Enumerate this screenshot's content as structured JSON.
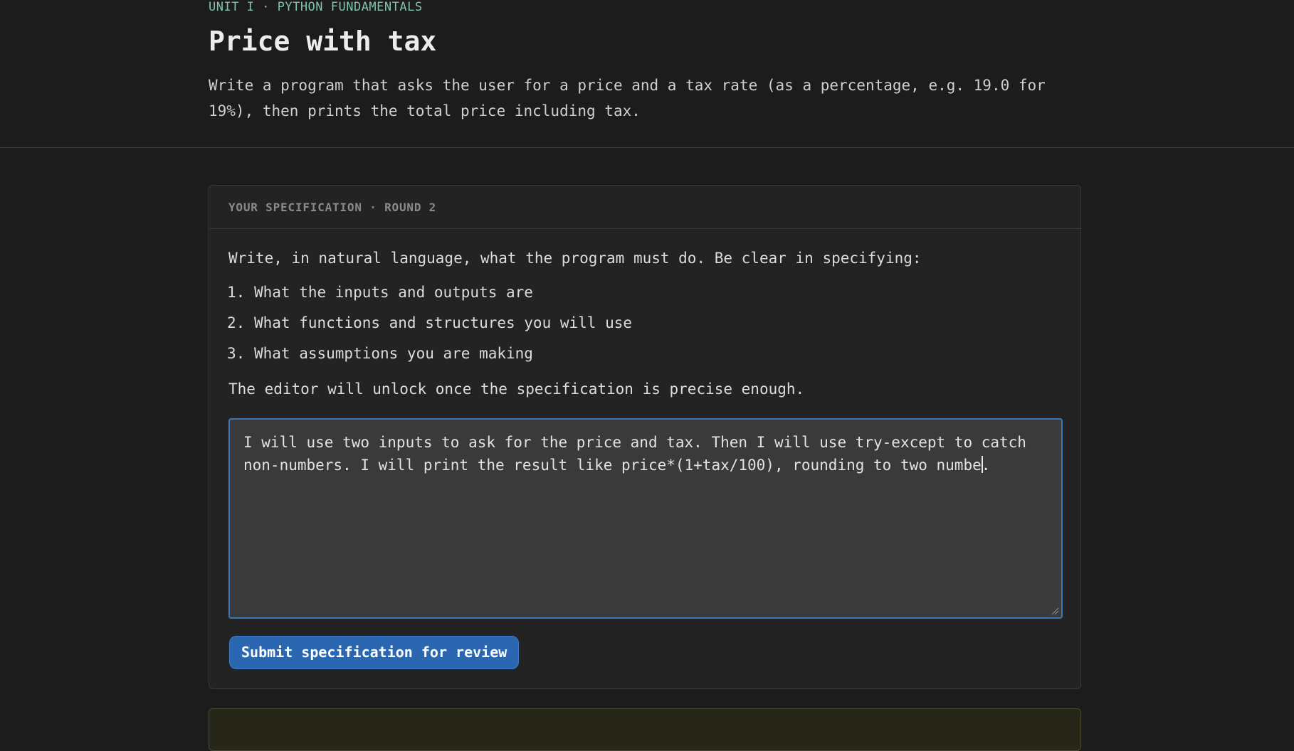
{
  "header": {
    "eyebrow": "UNIT I · PYTHON FUNDAMENTALS",
    "title": "Price with tax",
    "description": "Write a program that asks the user for a price and a tax rate (as a percentage, e.g. 19.0 for 19%), then prints the total price including tax."
  },
  "spec_card": {
    "header_label": "YOUR SPECIFICATION · ROUND 2",
    "instructions": "Write, in natural language, what the program must do. Be clear in specifying:",
    "criteria": [
      {
        "num": "1.",
        "text": "What the inputs and outputs are"
      },
      {
        "num": "2.",
        "text": "What functions and structures you will use"
      },
      {
        "num": "3.",
        "text": "What assumptions you are making"
      }
    ],
    "unlock_note": "The editor will unlock once the specification is precise enough.",
    "input": {
      "value_before_caret": "I will use two inputs to ask for the price and tax. Then I will use try-except to catch non-numbers. I will print the result like price*(1+tax/100), rounding to two numbe",
      "value_after_caret": "."
    },
    "submit_label": "Submit specification for review"
  },
  "colors": {
    "accent": "#2a67b0",
    "focus_border": "#3a78b8",
    "eyebrow": "#7fc4a9",
    "background": "#1c1c1c"
  }
}
